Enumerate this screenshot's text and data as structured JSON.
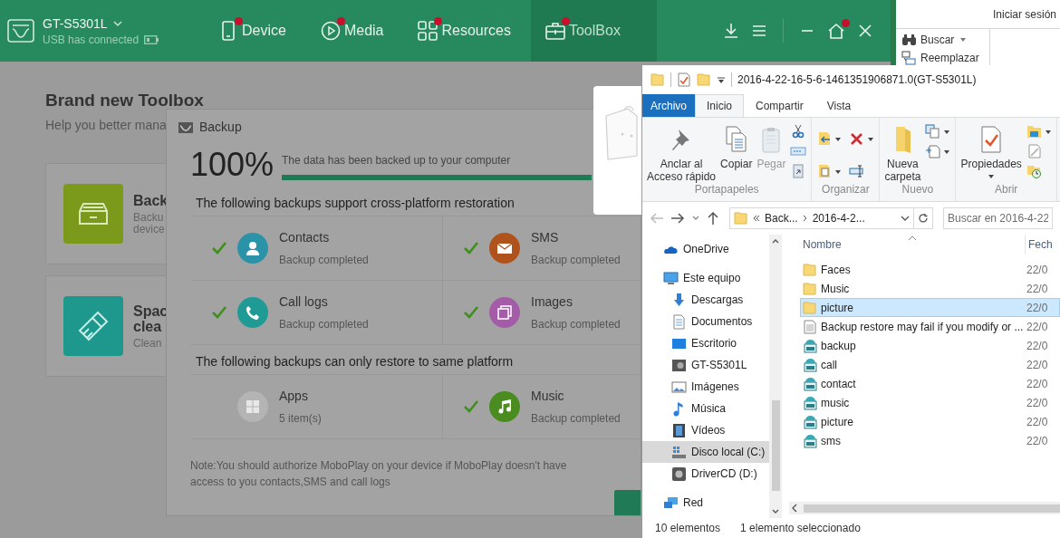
{
  "app": {
    "device_name": "GT-S5301L",
    "connection": "USB has connected",
    "home_badge": true,
    "tabs": [
      {
        "label": "Device",
        "kind": "device",
        "selected": false,
        "badge": true
      },
      {
        "label": "Media",
        "kind": "media",
        "selected": false,
        "badge": true
      },
      {
        "label": "Resources",
        "kind": "resources",
        "selected": false,
        "badge": true
      },
      {
        "label": "ToolBox",
        "kind": "toolbox",
        "selected": true,
        "badge": true
      }
    ],
    "page": {
      "title": "Brand new Toolbox",
      "subtitle": "Help you better mana",
      "cards": [
        {
          "kind": "backup",
          "title_lines": [
            "Back"
          ],
          "text_lines": [
            "Backu",
            "device"
          ]
        },
        {
          "kind": "cleaner",
          "title_lines": [
            "Spac",
            "clea"
          ],
          "text_lines": [
            "Clean"
          ]
        }
      ]
    },
    "dialog": {
      "title": "Backup",
      "percent": "100%",
      "message": "The data has been backed up to your computer",
      "level": 1,
      "sections": [
        {
          "heading": "The following backups support cross-platform restoration",
          "items": [
            {
              "kind": "contacts",
              "name": "Contacts",
              "status": "Backup completed",
              "checked": true,
              "color": "#2a93a8"
            },
            {
              "kind": "sms",
              "name": "SMS",
              "status": "Backup completed",
              "checked": true,
              "color": "#b0521c"
            },
            {
              "kind": "calls",
              "name": "Call logs",
              "status": "Backup completed",
              "checked": true,
              "color": "#1f9a94"
            },
            {
              "kind": "images",
              "name": "Images",
              "status": "Backup completed",
              "checked": true,
              "color": "#a45ca8"
            }
          ]
        },
        {
          "heading": "The following backups can only restore to same platform",
          "items": [
            {
              "kind": "apps",
              "name": "Apps",
              "status": "5 item(s)",
              "checked": false,
              "color": "#b4b4b4"
            },
            {
              "kind": "music",
              "name": "Music",
              "status": "Backup completed",
              "checked": true,
              "color": "#4a8c20"
            }
          ]
        }
      ],
      "note": "Note:You should authorize MoboPlay on your device if MoboPlay doesn't have access to you contacts,SMS and call logs"
    }
  },
  "word": {
    "sign_in": "Iniciar sesión",
    "commands": [
      {
        "label": "Buscar",
        "kind": "find",
        "dropdown": true
      },
      {
        "label": "Reemplazar",
        "kind": "replace",
        "dropdown": false
      }
    ]
  },
  "explorer": {
    "title": "2016-4-22-16-5-6-1461351906871.0(GT-S5301L)",
    "ribbon_tabs": [
      {
        "label": "Archivo",
        "kind": "file",
        "selected": false
      },
      {
        "label": "Inicio",
        "kind": "tab",
        "selected": true
      },
      {
        "label": "Compartir",
        "kind": "tab",
        "selected": false
      },
      {
        "label": "Vista",
        "kind": "tab",
        "selected": false
      }
    ],
    "groups": [
      {
        "label": "Portapapeles",
        "kind": "clipboard",
        "commands": [
          {
            "label": "Anclar al\nAcceso rápido",
            "kind": "pin",
            "disabled": false,
            "dropdown": false
          },
          {
            "label": "Copiar",
            "kind": "copy",
            "disabled": false,
            "dropdown": false
          },
          {
            "label": "Pegar",
            "kind": "paste",
            "disabled": true,
            "dropdown": false
          }
        ]
      },
      {
        "label": "Organizar",
        "kind": "organize"
      },
      {
        "label": "Nuevo",
        "kind": "new",
        "commands": [
          {
            "label": "Nueva\ncarpeta",
            "kind": "folder",
            "disabled": false,
            "dropdown": false
          }
        ]
      },
      {
        "label": "Abrir",
        "kind": "open",
        "commands": [
          {
            "label": "Propiedades",
            "kind": "properties",
            "disabled": false,
            "dropdown": true
          }
        ]
      }
    ],
    "crumbs": [
      "Back...",
      "2016-4-2..."
    ],
    "search": {
      "placeholder": "Buscar en 2016-4-22"
    },
    "nav": [
      {
        "label": "OneDrive",
        "kind": "cloud",
        "selected": false
      },
      {
        "label": "Este equipo",
        "kind": "computer",
        "selected": false,
        "children": [
          {
            "label": "Descargas",
            "kind": "downloads",
            "selected": false
          },
          {
            "label": "Documentos",
            "kind": "documents",
            "selected": false
          },
          {
            "label": "Escritorio",
            "kind": "desktop",
            "selected": false
          },
          {
            "label": "GT-S5301L",
            "kind": "device",
            "selected": false
          },
          {
            "label": "Imágenes",
            "kind": "pictures",
            "selected": false
          },
          {
            "label": "Música",
            "kind": "music",
            "selected": false
          },
          {
            "label": "Vídeos",
            "kind": "videos",
            "selected": false
          },
          {
            "label": "Disco local (C:)",
            "kind": "drive",
            "selected": true
          },
          {
            "label": "DriverCD (D:)",
            "kind": "disc",
            "selected": false
          }
        ]
      },
      {
        "label": "Red",
        "kind": "network",
        "selected": false
      }
    ],
    "columns": [
      "Nombre",
      "Fech"
    ],
    "files": [
      {
        "name": "Faces",
        "kind": "folder",
        "date": "22/0",
        "selected": false
      },
      {
        "name": "Music",
        "kind": "folder",
        "date": "22/0",
        "selected": false
      },
      {
        "name": "picture",
        "kind": "folder",
        "date": "22/0",
        "selected": true
      },
      {
        "name": "Backup restore may fail if you modify or ...",
        "kind": "text",
        "date": "22/0",
        "selected": false
      },
      {
        "name": "backup",
        "kind": "dat",
        "date": "22/0",
        "selected": false
      },
      {
        "name": "call",
        "kind": "dat",
        "date": "22/0",
        "selected": false
      },
      {
        "name": "contact",
        "kind": "dat",
        "date": "22/0",
        "selected": false
      },
      {
        "name": "music",
        "kind": "dat",
        "date": "22/0",
        "selected": false
      },
      {
        "name": "picture",
        "kind": "dat",
        "date": "22/0",
        "selected": false
      },
      {
        "name": "sms",
        "kind": "dat",
        "date": "22/0",
        "selected": false
      }
    ],
    "status": [
      "10 elementos",
      "1 elemento seleccionado"
    ]
  }
}
